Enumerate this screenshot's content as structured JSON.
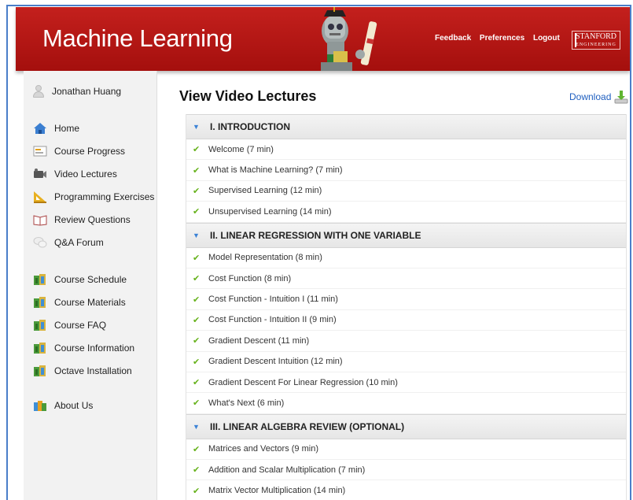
{
  "header": {
    "title": "Machine Learning",
    "links": [
      "Feedback",
      "Preferences",
      "Logout"
    ],
    "logo_main": "STANFORD",
    "logo_sub": "ENGINEERING"
  },
  "user": {
    "name": "Jonathan Huang"
  },
  "sidebar": {
    "items": [
      {
        "label": "Home",
        "icon": "home-icon"
      },
      {
        "label": "Course Progress",
        "icon": "progress-icon"
      },
      {
        "label": "Video Lectures",
        "icon": "video-icon"
      },
      {
        "label": "Programming Exercises",
        "icon": "exercise-icon"
      },
      {
        "label": "Review Questions",
        "icon": "review-icon"
      },
      {
        "label": "Q&A Forum",
        "icon": "forum-icon"
      },
      {
        "label": "Course Schedule",
        "icon": "doc-icon"
      },
      {
        "label": "Course Materials",
        "icon": "doc-icon"
      },
      {
        "label": "Course FAQ",
        "icon": "doc-icon"
      },
      {
        "label": "Course Information",
        "icon": "doc-icon"
      },
      {
        "label": "Octave Installation",
        "icon": "doc-icon"
      },
      {
        "label": "About Us",
        "icon": "about-icon"
      }
    ]
  },
  "main": {
    "title": "View Video Lectures",
    "download_label": "Download",
    "sections": [
      {
        "title": "I. INTRODUCTION",
        "lectures": [
          "Welcome (7 min)",
          "What is Machine Learning? (7 min)",
          "Supervised Learning (12 min)",
          "Unsupervised Learning (14 min)"
        ]
      },
      {
        "title": "II. LINEAR REGRESSION WITH ONE VARIABLE",
        "lectures": [
          "Model Representation (8 min)",
          "Cost Function (8 min)",
          "Cost Function - Intuition I (11 min)",
          "Cost Function - Intuition II (9 min)",
          "Gradient Descent (11 min)",
          "Gradient Descent Intuition (12 min)",
          "Gradient Descent For Linear Regression (10 min)",
          "What's Next (6 min)"
        ]
      },
      {
        "title": "III. LINEAR ALGEBRA REVIEW (OPTIONAL)",
        "lectures": [
          "Matrices and Vectors (9 min)",
          "Addition and Scalar Multiplication (7 min)",
          "Matrix Vector Multiplication (14 min)"
        ]
      }
    ]
  },
  "colors": {
    "header": "#b5170f",
    "link": "#1f5fc0",
    "check": "#66b21b",
    "chevron": "#3b82d6"
  }
}
